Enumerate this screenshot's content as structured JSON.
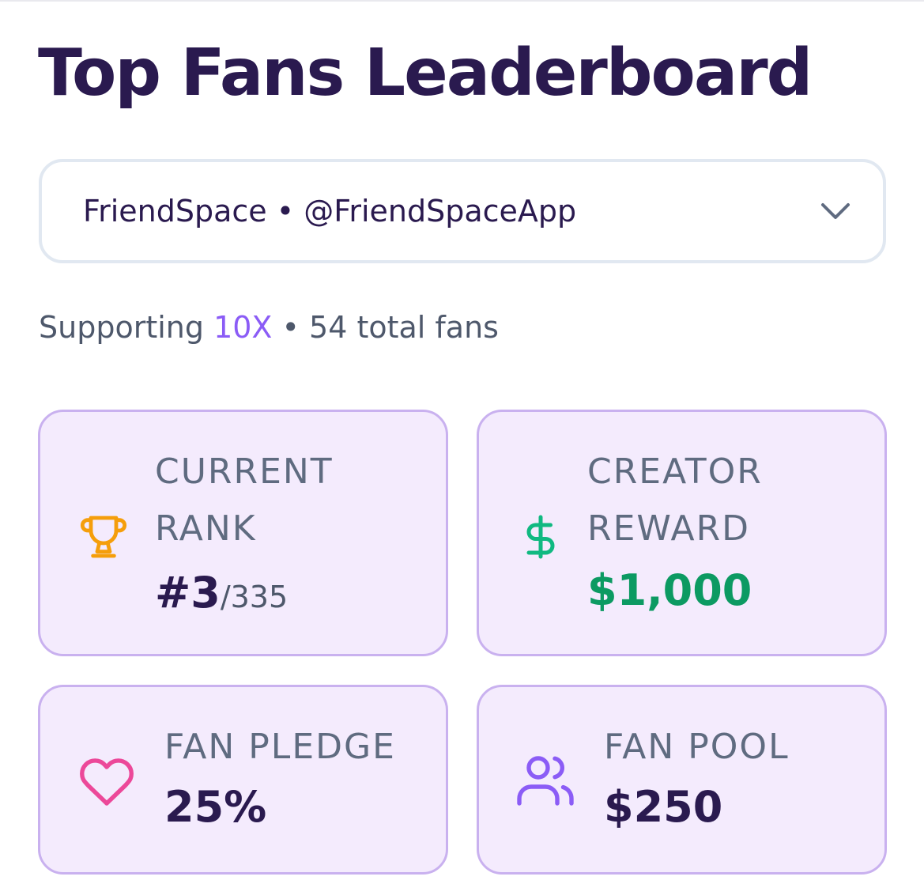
{
  "header": {
    "title": "Top Fans Leaderboard"
  },
  "selector": {
    "value": "FriendSpace • @FriendSpaceApp",
    "icon": "chevron-down-icon"
  },
  "summary": {
    "prefix": "Supporting ",
    "highlight": "10X",
    "suffix": " • 54 total fans"
  },
  "stats": {
    "rank": {
      "label_line1": "CURRENT",
      "label_line2": "RANK",
      "value": "#3",
      "total": "/335",
      "icon": "trophy-icon",
      "icon_color": "#f59e0b"
    },
    "reward": {
      "label_line1": "CREATOR",
      "label_line2": "REWARD",
      "value": "$1,000",
      "icon": "dollar-icon",
      "icon_color": "#10b981"
    },
    "pledge": {
      "label": "FAN PLEDGE",
      "value": "25%",
      "icon": "heart-icon",
      "icon_color": "#ec4899"
    },
    "pool": {
      "label": "FAN POOL",
      "value": "$250",
      "icon": "users-icon",
      "icon_color": "#8b5cf6"
    }
  },
  "colors": {
    "title": "#2a1a4f",
    "accent": "#8b5cf6",
    "card_bg": "#f4ebfd",
    "card_border": "#c9b1ef",
    "reward_value": "#0c9a62"
  }
}
